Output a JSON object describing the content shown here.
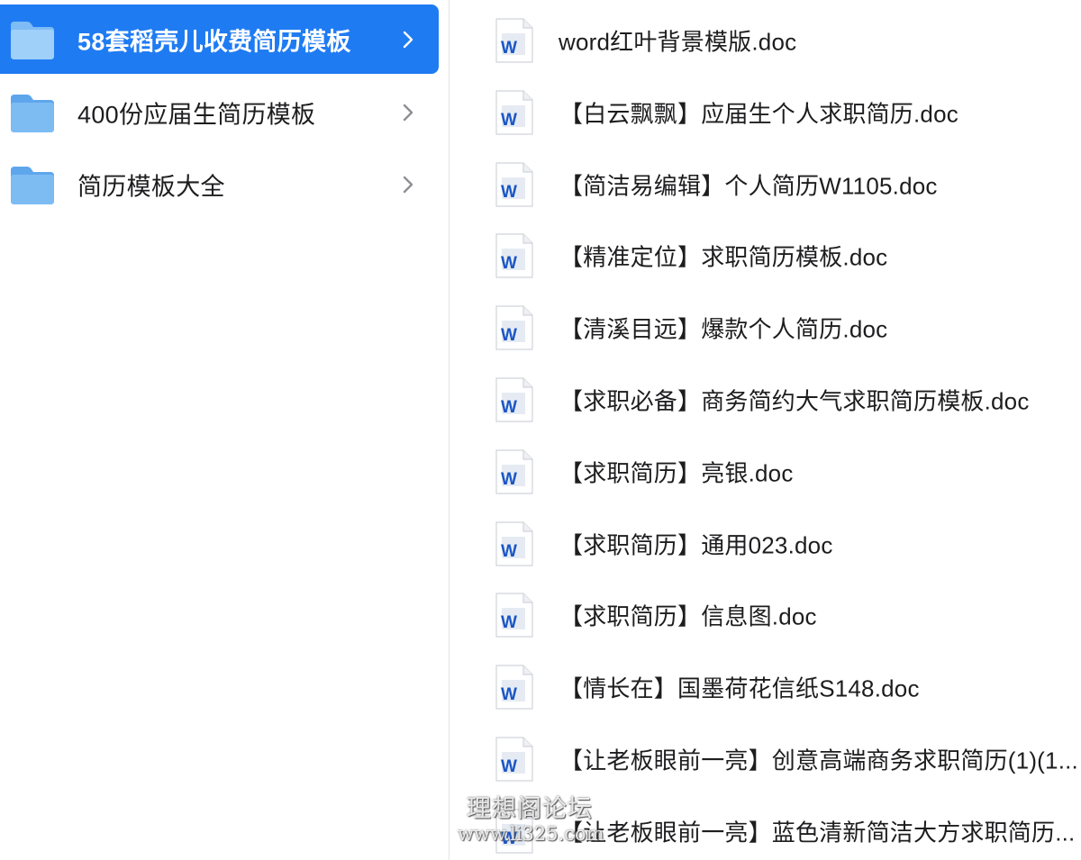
{
  "sidebar": {
    "folders": [
      {
        "label": "58套稻壳儿收费简历模板",
        "selected": true
      },
      {
        "label": "400份应届生简历模板",
        "selected": false
      },
      {
        "label": "简历模板大全",
        "selected": false
      }
    ]
  },
  "files": [
    {
      "name": "word红叶背景模版.doc",
      "icon": "word-doc-icon"
    },
    {
      "name": "【白云飘飘】应届生个人求职简历.doc",
      "icon": "word-doc-icon"
    },
    {
      "name": "【简洁易编辑】个人简历W1105.doc",
      "icon": "word-doc-icon"
    },
    {
      "name": "【精准定位】求职简历模板.doc",
      "icon": "word-doc-icon"
    },
    {
      "name": "【清溪目远】爆款个人简历.doc",
      "icon": "word-doc-icon"
    },
    {
      "name": "【求职必备】商务简约大气求职简历模板.doc",
      "icon": "word-doc-icon"
    },
    {
      "name": "【求职简历】亮银.doc",
      "icon": "word-doc-icon"
    },
    {
      "name": "【求职简历】通用023.doc",
      "icon": "word-doc-icon"
    },
    {
      "name": "【求职简历】信息图.doc",
      "icon": "word-doc-icon"
    },
    {
      "name": "【情长在】国墨荷花信纸S148.doc",
      "icon": "word-doc-icon"
    },
    {
      "name": "【让老板眼前一亮】创意高端商务求职简历(1)(1...",
      "icon": "word-doc-icon"
    },
    {
      "name": "【让老板眼前一亮】蓝色清新简洁大方求职简历...",
      "icon": "word-doc-icon"
    }
  ],
  "watermark": {
    "line1": "理想阁论坛",
    "line2": "www.li325.com"
  },
  "colors": {
    "selection": "#1f7bf2",
    "folder": "#6aaef0",
    "word_blue": "#1a56c4"
  }
}
